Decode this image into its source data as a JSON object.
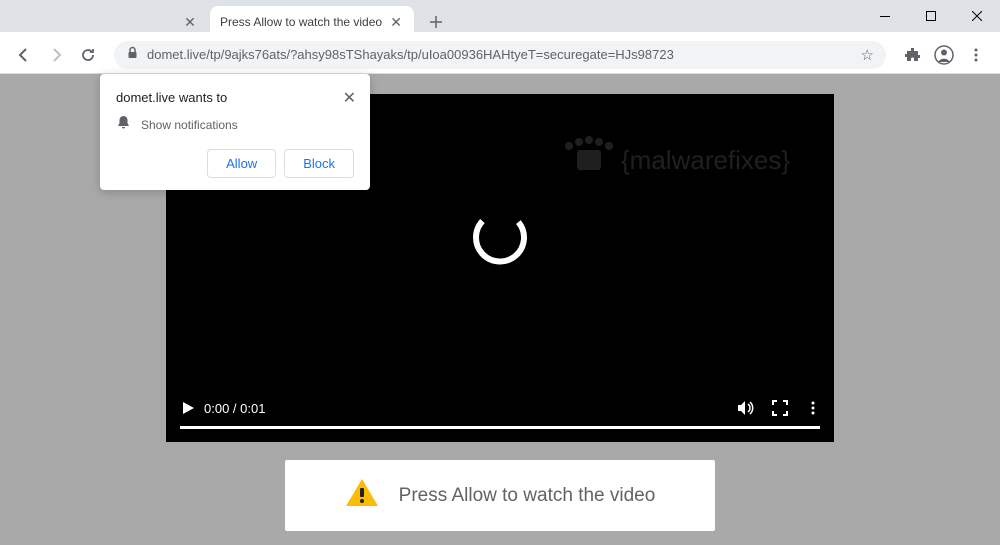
{
  "window": {
    "title": ""
  },
  "tabs": [
    {
      "title": "",
      "active": false
    },
    {
      "title": "Press Allow to watch the video",
      "active": true
    }
  ],
  "address": {
    "url": "domet.live/tp/9ajks76ats/?ahsy98sTShayaks/tp/uIoa00936HAHtyeT=securegate=HJs98723"
  },
  "permission": {
    "prompt": "domet.live wants to",
    "request_text": "Show notifications",
    "allow_label": "Allow",
    "block_label": "Block"
  },
  "video": {
    "time_display": "0:00 / 0:01",
    "watermark_text": "{malwarefixes}"
  },
  "instruction": {
    "text": "Press Allow to watch the video"
  }
}
